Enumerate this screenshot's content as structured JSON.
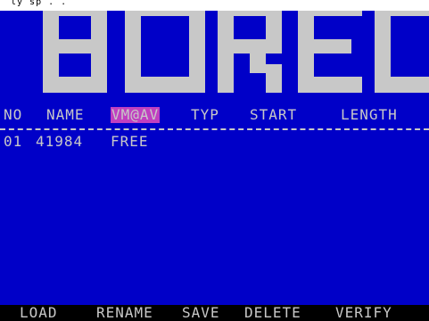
{
  "logo": {
    "text": "BOREC",
    "color": "#c8c8c8",
    "top_strip_text": "ly sp . ."
  },
  "colors": {
    "background": "#0000c8",
    "text": "#c8c8c8",
    "highlight": "#c040c0",
    "menu_bar": "#000000"
  },
  "header": {
    "no": "NO",
    "name": "NAME",
    "vmav": "VM@AV",
    "typ": "TYP",
    "start": "START",
    "length": "LENGTH"
  },
  "entries": [
    {
      "no": "01",
      "size": "41984",
      "status": "FREE"
    }
  ],
  "menu": {
    "load": "LOAD",
    "rename": "RENAME",
    "save": "SAVE",
    "delete": "DELETE",
    "verify": "VERIFY"
  }
}
